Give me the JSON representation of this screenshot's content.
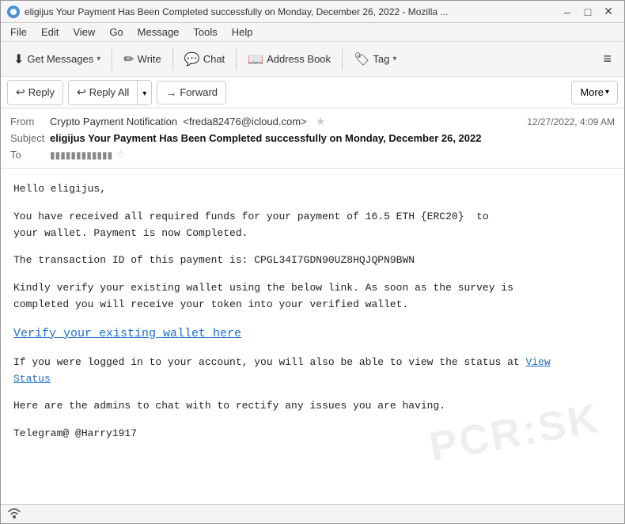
{
  "window": {
    "title": "eligijus Your Payment Has Been Completed successfully on Monday, December 26, 2022 - Mozilla ...",
    "title_short": "eligijus Your Payment Has Been Completed successfully on Monday, December 26, 2022 - Mozilla ..."
  },
  "menu": {
    "items": [
      "File",
      "Edit",
      "View",
      "Go",
      "Message",
      "Tools",
      "Help"
    ]
  },
  "toolbar": {
    "get_messages": "Get Messages",
    "write": "Write",
    "chat": "Chat",
    "address_book": "Address Book",
    "tag": "Tag",
    "menu_icon": "≡"
  },
  "actions": {
    "reply": "Reply",
    "reply_all": "Reply All",
    "forward": "Forward",
    "more": "More"
  },
  "email": {
    "from_label": "From",
    "from_name": "Crypto Payment Notification",
    "from_email": "<freda82476@icloud.com>",
    "subject_label": "Subject",
    "subject": "eligijus Your Payment Has Been Completed successfully on Monday, December 26, 2022",
    "to_label": "To",
    "to_email": "eligijus@pcrisk.com",
    "date": "12/27/2022, 4:09 AM",
    "body_lines": [
      "Hello eligijus,",
      "",
      "You have received all required funds for your payment of 16.5 ETH {ERC20}  to\nyour wallet. Payment is now Completed.",
      "",
      "The transaction ID of this payment is: CPGL34I7GDN90UZ8HQJQPN9BWN",
      "",
      "Kindly verify your existing wallet using the below link. As soon as the survey is\ncompleted you will receive your token into your verified wallet.",
      "",
      "",
      "",
      "If you were logged in to your account, you will also be able to view the status at",
      "",
      "",
      "Here are the admins to chat with to rectify any issues you are having.",
      "",
      "Telegram@ @Harry1917"
    ],
    "verify_link": "Verify your existing wallet here",
    "view_status_link": "View\nStatus",
    "watermark": "PCR:SK"
  },
  "status": {
    "icon": "📡"
  }
}
